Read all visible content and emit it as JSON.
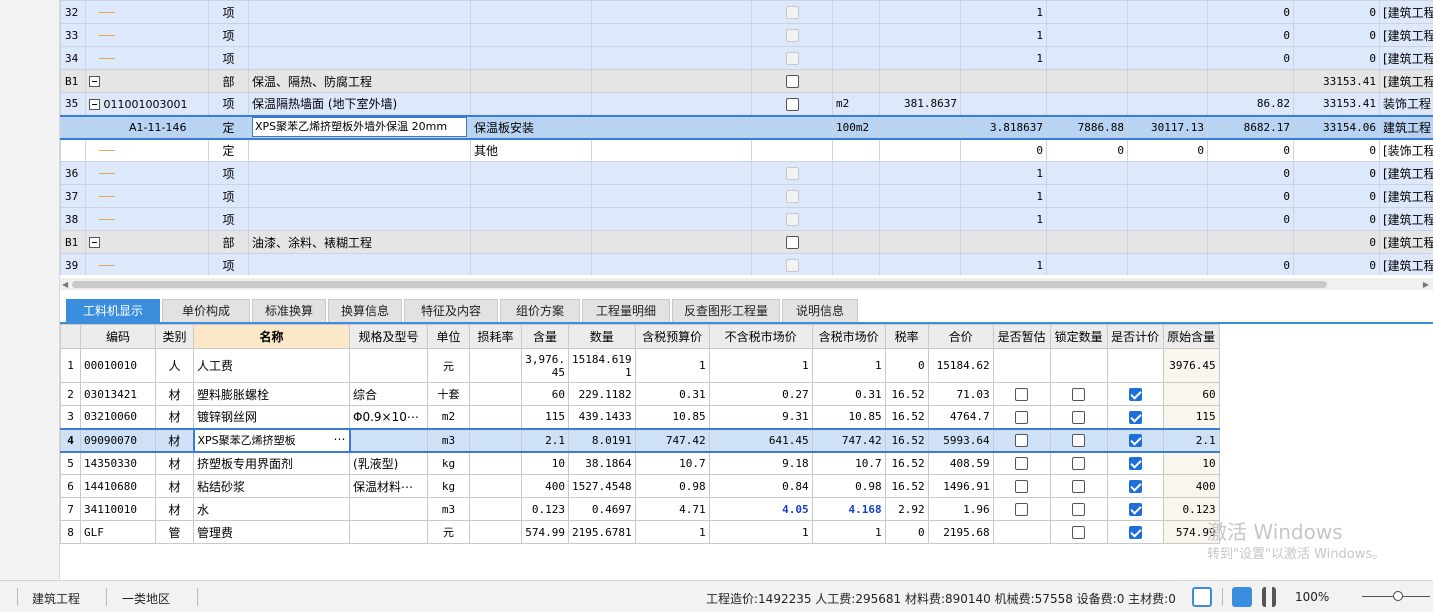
{
  "upper_rows": [
    {
      "type": "item",
      "rowno": "32",
      "tree": "line",
      "cat": "项",
      "name": "",
      "spec": "",
      "cb": "dis",
      "unit": "",
      "qty": "",
      "c1": "1",
      "c2": "",
      "c3": "",
      "c4": "0",
      "c5": "0",
      "prof": "[建筑工程"
    },
    {
      "type": "item",
      "rowno": "33",
      "tree": "line",
      "cat": "项",
      "name": "",
      "spec": "",
      "cb": "dis",
      "unit": "",
      "qty": "",
      "c1": "1",
      "c2": "",
      "c3": "",
      "c4": "0",
      "c5": "0",
      "prof": "[建筑工程"
    },
    {
      "type": "item",
      "rowno": "34",
      "tree": "line",
      "cat": "项",
      "name": "",
      "spec": "",
      "cb": "dis",
      "unit": "",
      "qty": "",
      "c1": "1",
      "c2": "",
      "c3": "",
      "c4": "0",
      "c5": "0",
      "prof": "[建筑工程"
    },
    {
      "type": "section",
      "rowno": "B1",
      "tree": "expand",
      "cat": "部",
      "name": "保温、隔热、防腐工程",
      "spec": "",
      "cb": "on-white",
      "unit": "",
      "qty": "",
      "c1": "",
      "c2": "",
      "c3": "",
      "c4": "",
      "c5": "33153.41",
      "prof": "[建筑工程"
    },
    {
      "type": "item",
      "rowno": "35",
      "tree": "expand-code",
      "code": "011001003001",
      "cat": "项",
      "name": "保温隔热墙面 (地下室外墙)",
      "spec": "",
      "cb": "on-white",
      "unit": "m2",
      "qty": "381.8637",
      "c1": "",
      "c2": "",
      "c3": "",
      "c4": "86.82",
      "c5": "33153.41",
      "prof": "装饰工程"
    },
    {
      "type": "sel",
      "rowno": "",
      "tree": "code",
      "code": "A1-11-146",
      "cat": "定",
      "name": "XPS聚苯乙烯挤塑板外墙外保温 20mm",
      "spec": "保温板安装",
      "cb": "",
      "unit": "100m2",
      "qty": "",
      "c1": "3.818637",
      "c2": "7886.88",
      "c3": "30117.13",
      "c4": "8682.17",
      "c5": "33154.06",
      "prof": "建筑工程"
    },
    {
      "type": "plain",
      "rowno": "",
      "tree": "line",
      "cat": "定",
      "name": "",
      "spec": "其他",
      "cb": "",
      "unit": "",
      "qty": "",
      "c1": "0",
      "c2": "0",
      "c3": "0",
      "c4": "0",
      "c5": "0",
      "prof": "[装饰工程"
    },
    {
      "type": "item",
      "rowno": "36",
      "tree": "line",
      "cat": "项",
      "name": "",
      "spec": "",
      "cb": "dis",
      "unit": "",
      "qty": "",
      "c1": "1",
      "c2": "",
      "c3": "",
      "c4": "0",
      "c5": "0",
      "prof": "[建筑工程"
    },
    {
      "type": "item",
      "rowno": "37",
      "tree": "line",
      "cat": "项",
      "name": "",
      "spec": "",
      "cb": "dis",
      "unit": "",
      "qty": "",
      "c1": "1",
      "c2": "",
      "c3": "",
      "c4": "0",
      "c5": "0",
      "prof": "[建筑工程"
    },
    {
      "type": "item",
      "rowno": "38",
      "tree": "line",
      "cat": "项",
      "name": "",
      "spec": "",
      "cb": "dis",
      "unit": "",
      "qty": "",
      "c1": "1",
      "c2": "",
      "c3": "",
      "c4": "0",
      "c5": "0",
      "prof": "[建筑工程"
    },
    {
      "type": "section",
      "rowno": "B1",
      "tree": "expand",
      "cat": "部",
      "name": "油漆、涂料、裱糊工程",
      "spec": "",
      "cb": "on-white",
      "unit": "",
      "qty": "",
      "c1": "",
      "c2": "",
      "c3": "",
      "c4": "",
      "c5": "0",
      "prof": "[建筑工程"
    },
    {
      "type": "item",
      "rowno": "39",
      "tree": "line",
      "cat": "项",
      "name": "",
      "spec": "",
      "cb": "dis",
      "unit": "",
      "qty": "",
      "c1": "1",
      "c2": "",
      "c3": "",
      "c4": "0",
      "c5": "0",
      "prof": "[建筑工程"
    }
  ],
  "tabs": [
    "工料机显示",
    "单价构成",
    "标准换算",
    "换算信息",
    "特征及内容",
    "组价方案",
    "工程量明细",
    "反查图形工程量",
    "说明信息"
  ],
  "active_tab": 0,
  "lower_headers": [
    "",
    "编码",
    "类别",
    "名称",
    "规格及型号",
    "单位",
    "损耗率",
    "含量",
    "数量",
    "含税预算价",
    "不含税市场价",
    "含税市场价",
    "税率",
    "合价",
    "是否暂估",
    "锁定数量",
    "是否计价",
    "原始含量"
  ],
  "lower_rows": [
    {
      "no": "1",
      "code": "00010010",
      "type": "人",
      "name": "人工费",
      "spec": "",
      "unit": "元",
      "loss": "",
      "content": "3,976.45",
      "qty": "15184.6191",
      "budget": "1",
      "mkt_ex": "1",
      "mkt_in": "1",
      "tax": "0",
      "total": "15184.62",
      "est": null,
      "lock": null,
      "price": null,
      "orig": "3976.45"
    },
    {
      "no": "2",
      "code": "03013421",
      "type": "材",
      "name": "塑料膨胀螺栓",
      "spec": "综合",
      "unit": "十套",
      "loss": "",
      "content": "60",
      "qty": "229.1182",
      "budget": "0.31",
      "mkt_ex": "0.27",
      "mkt_in": "0.31",
      "tax": "16.52",
      "total": "71.03",
      "est": false,
      "lock": false,
      "price": true,
      "orig": "60"
    },
    {
      "no": "3",
      "code": "03210060",
      "type": "材",
      "name": "镀锌钢丝网",
      "spec": "Φ0.9×10⋯",
      "unit": "m2",
      "loss": "",
      "content": "115",
      "qty": "439.1433",
      "budget": "10.85",
      "mkt_ex": "9.31",
      "mkt_in": "10.85",
      "tax": "16.52",
      "total": "4764.7",
      "est": false,
      "lock": false,
      "price": true,
      "orig": "115"
    },
    {
      "no": "4",
      "code": "09090070",
      "type": "材",
      "name": "XPS聚苯乙烯挤塑板",
      "spec": "",
      "unit": "m3",
      "loss": "",
      "content": "2.1",
      "qty": "8.0191",
      "budget": "747.42",
      "mkt_ex": "641.45",
      "mkt_in": "747.42",
      "tax": "16.52",
      "total": "5993.64",
      "est": false,
      "lock": false,
      "price": true,
      "orig": "2.1",
      "selected": true
    },
    {
      "no": "5",
      "code": "14350330",
      "type": "材",
      "name": "挤塑板专用界面剂",
      "spec": "(乳液型)",
      "unit": "kg",
      "loss": "",
      "content": "10",
      "qty": "38.1864",
      "budget": "10.7",
      "mkt_ex": "9.18",
      "mkt_in": "10.7",
      "tax": "16.52",
      "total": "408.59",
      "est": false,
      "lock": false,
      "price": true,
      "orig": "10"
    },
    {
      "no": "6",
      "code": "14410680",
      "type": "材",
      "name": "粘结砂浆",
      "spec": "保温材料⋯",
      "unit": "kg",
      "loss": "",
      "content": "400",
      "qty": "1527.4548",
      "budget": "0.98",
      "mkt_ex": "0.84",
      "mkt_in": "0.98",
      "tax": "16.52",
      "total": "1496.91",
      "est": false,
      "lock": false,
      "price": true,
      "orig": "400"
    },
    {
      "no": "7",
      "code": "34110010",
      "type": "材",
      "name": "水",
      "spec": "",
      "unit": "m3",
      "loss": "",
      "content": "0.123",
      "qty": "0.4697",
      "budget": "4.71",
      "mkt_ex": "4.05",
      "mkt_in": "4.168",
      "tax": "2.92",
      "total": "1.96",
      "est": false,
      "lock": false,
      "price": true,
      "orig": "0.123",
      "highlight": true
    },
    {
      "no": "8",
      "code": "GLF",
      "type": "管",
      "name": "管理费",
      "spec": "",
      "unit": "元",
      "loss": "",
      "content": "574.99",
      "qty": "2195.6781",
      "budget": "1",
      "mkt_ex": "1",
      "mkt_in": "1",
      "tax": "0",
      "total": "2195.68",
      "est": null,
      "lock": false,
      "price": true,
      "orig": "574.99"
    }
  ],
  "watermark": {
    "line1": "激活 Windows",
    "line2": "转到\"设置\"以激活 Windows。"
  },
  "status": {
    "profession": "建筑工程",
    "region": "一类地区",
    "summary": "工程造价:1492235  人工费:295681  材料费:890140  机械费:57558  设备费:0  主材费:0",
    "zoom": "100%"
  },
  "colors": {
    "accent": "#3b8ede",
    "selection": "#3a7bd5",
    "highlight_text": "#1a3fd0"
  }
}
